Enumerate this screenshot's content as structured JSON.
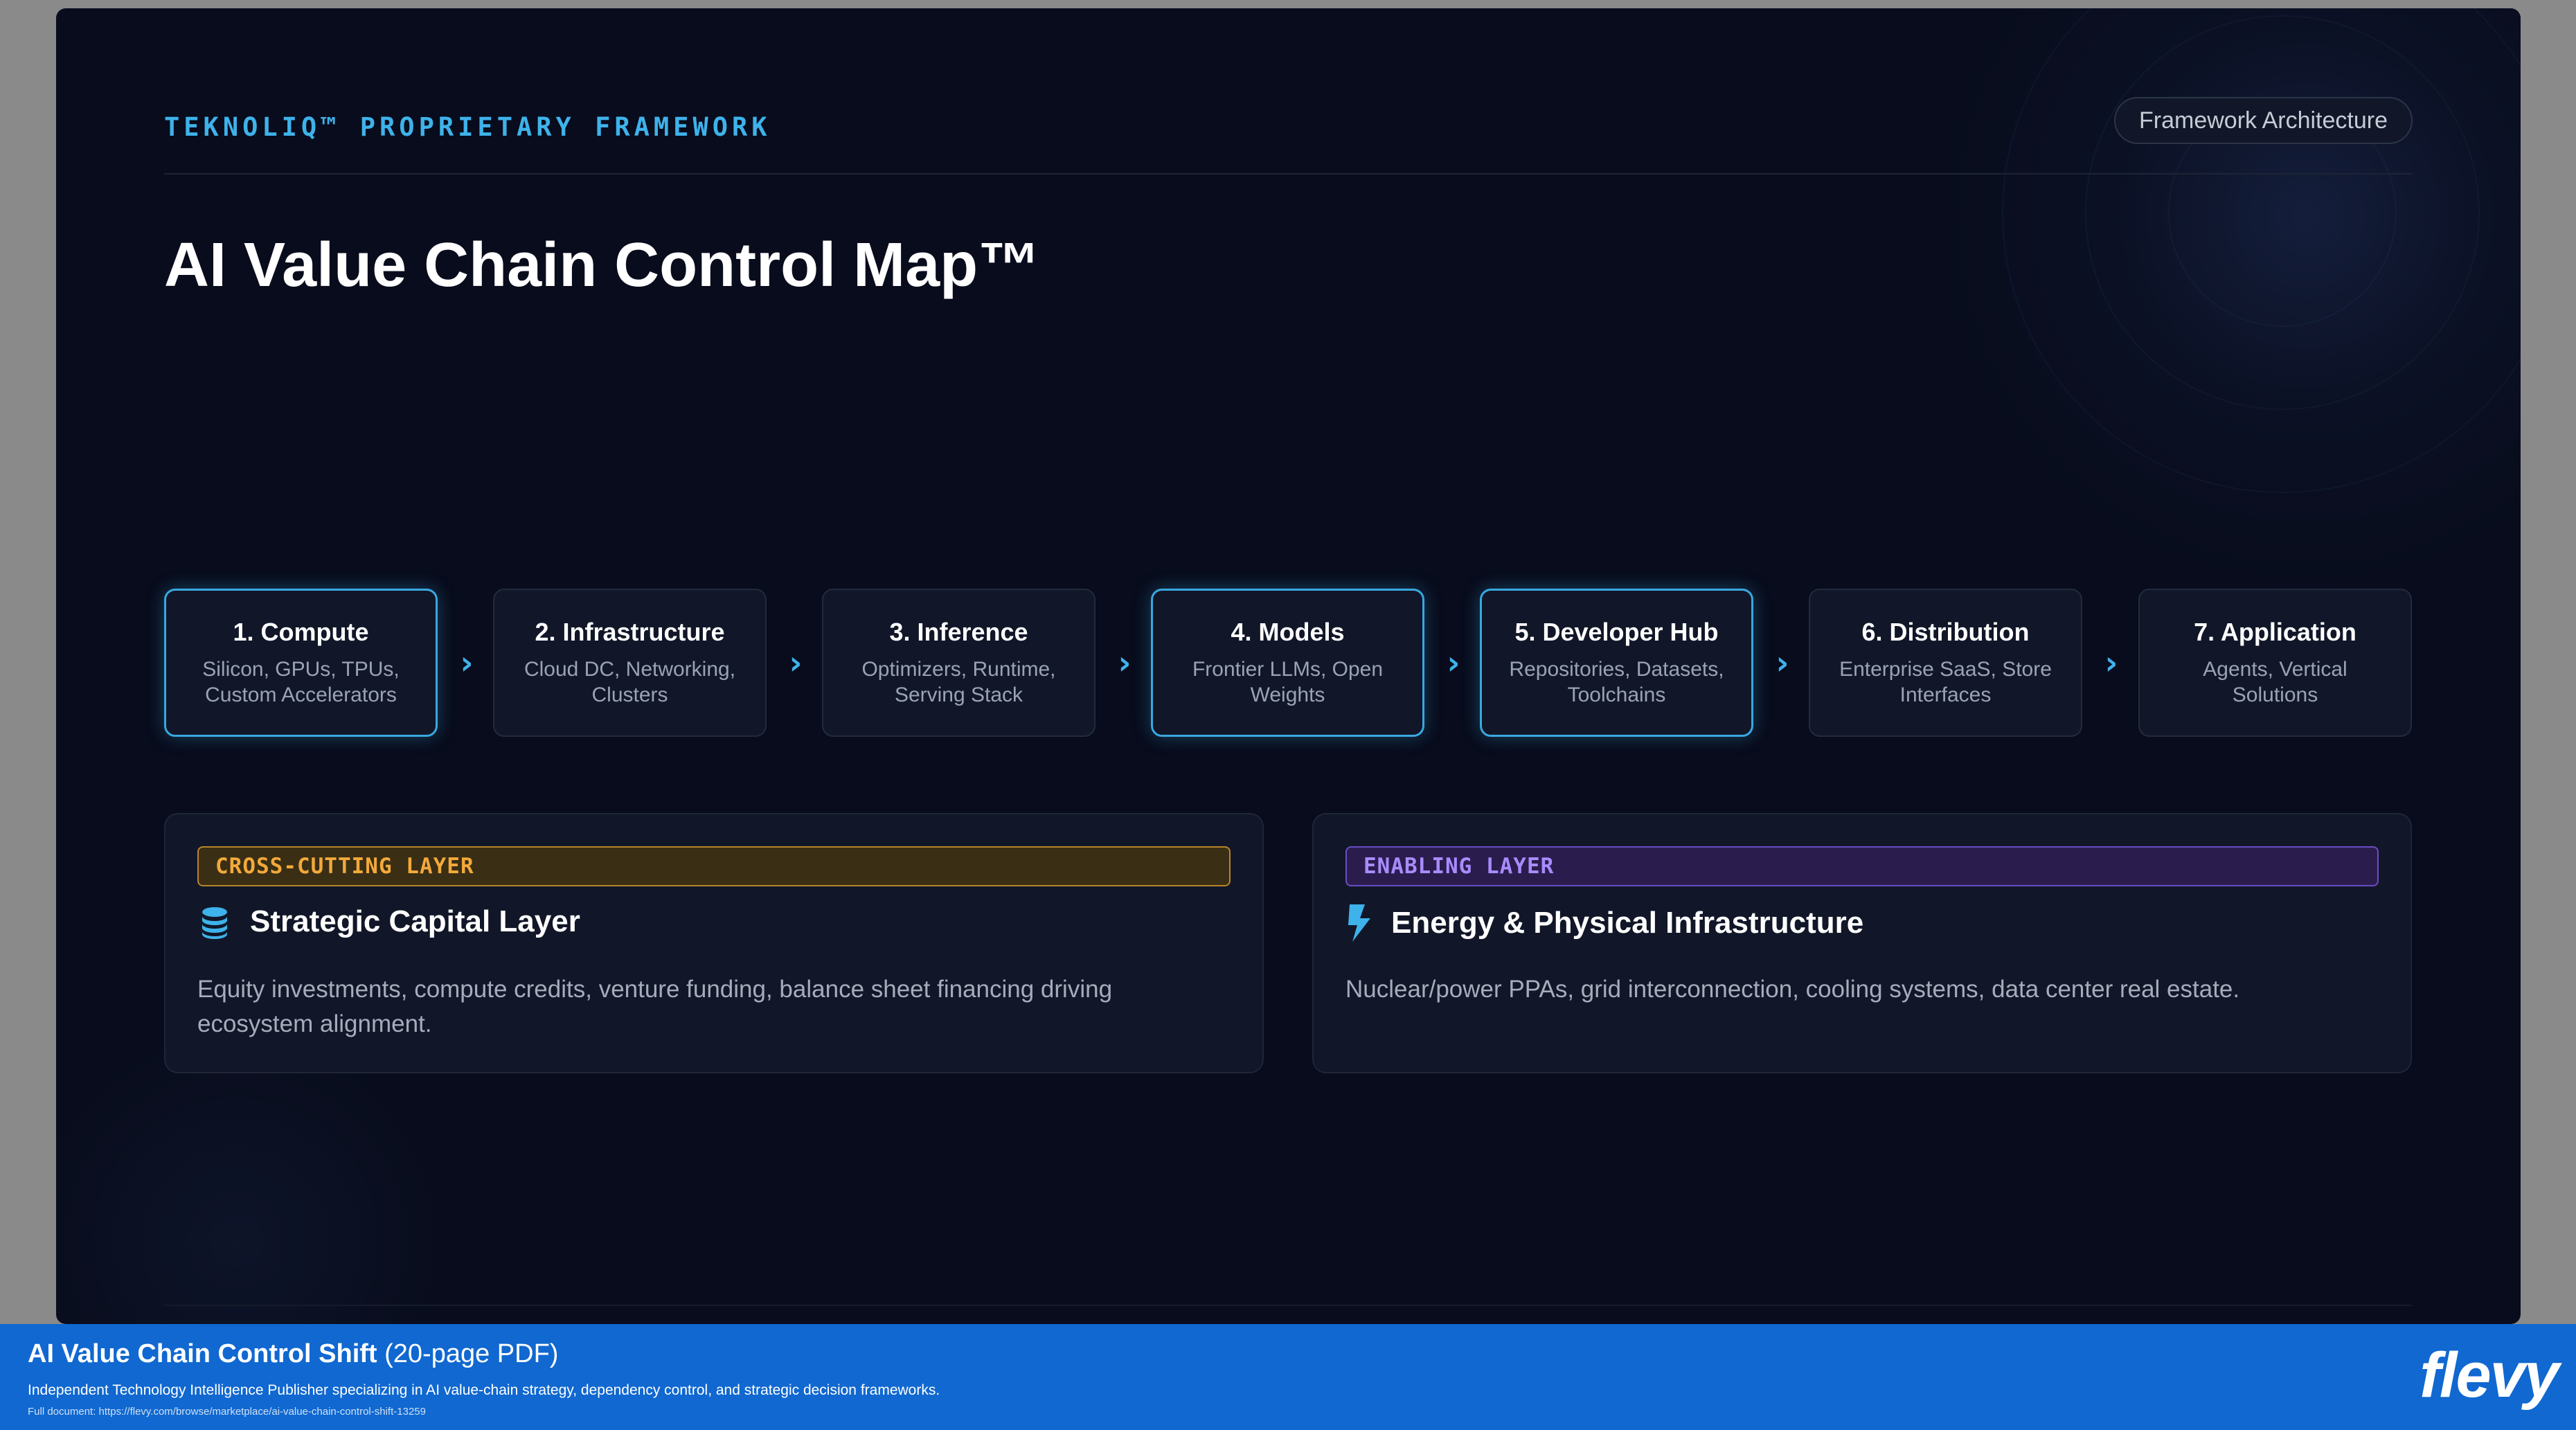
{
  "header": {
    "kicker": "TEKNOLIQ™ PROPRIETARY FRAMEWORK",
    "badge": "Framework Architecture",
    "title": "AI Value Chain Control Map™"
  },
  "stages": [
    {
      "title": "1. Compute",
      "desc": "Silicon, GPUs, TPUs, Custom Accelerators"
    },
    {
      "title": "2. Infrastructure",
      "desc": "Cloud DC, Networking, Clusters"
    },
    {
      "title": "3. Inference",
      "desc": "Optimizers, Runtime, Serving Stack"
    },
    {
      "title": "4. Models",
      "desc": "Frontier LLMs, Open Weights"
    },
    {
      "title": "5. Developer Hub",
      "desc": "Repositories, Datasets, Toolchains"
    },
    {
      "title": "6. Distribution",
      "desc": "Enterprise SaaS, Store Interfaces"
    },
    {
      "title": "7. Application",
      "desc": "Agents, Vertical Solutions"
    }
  ],
  "layers": {
    "cross_cutting": {
      "tag": "CROSS-CUTTING LAYER",
      "title": "Strategic Capital Layer",
      "desc": "Equity investments, compute credits, venture funding, balance sheet financing driving ecosystem alignment.",
      "icon": "coins-icon"
    },
    "enabling": {
      "tag": "ENABLING LAYER",
      "title": "Energy & Physical Infrastructure",
      "desc": "Nuclear/power PPAs, grid interconnection, cooling systems, data center real estate.",
      "icon": "lightning-icon"
    }
  },
  "banner": {
    "title_bold": "AI Value Chain Control Shift",
    "title_rest": " (20-page PDF)",
    "subtitle": "Independent Technology Intelligence Publisher specializing in AI value-chain strategy, dependency control, and strategic decision frameworks.",
    "link": "Full document: https://flevy.com/browse/marketplace/ai-value-chain-control-shift-13259",
    "logo": "flevy"
  },
  "colors": {
    "accent": "#3eb2ea",
    "gold": "#f2a93b",
    "purple": "#a98bff",
    "banner": "#1068d0"
  }
}
